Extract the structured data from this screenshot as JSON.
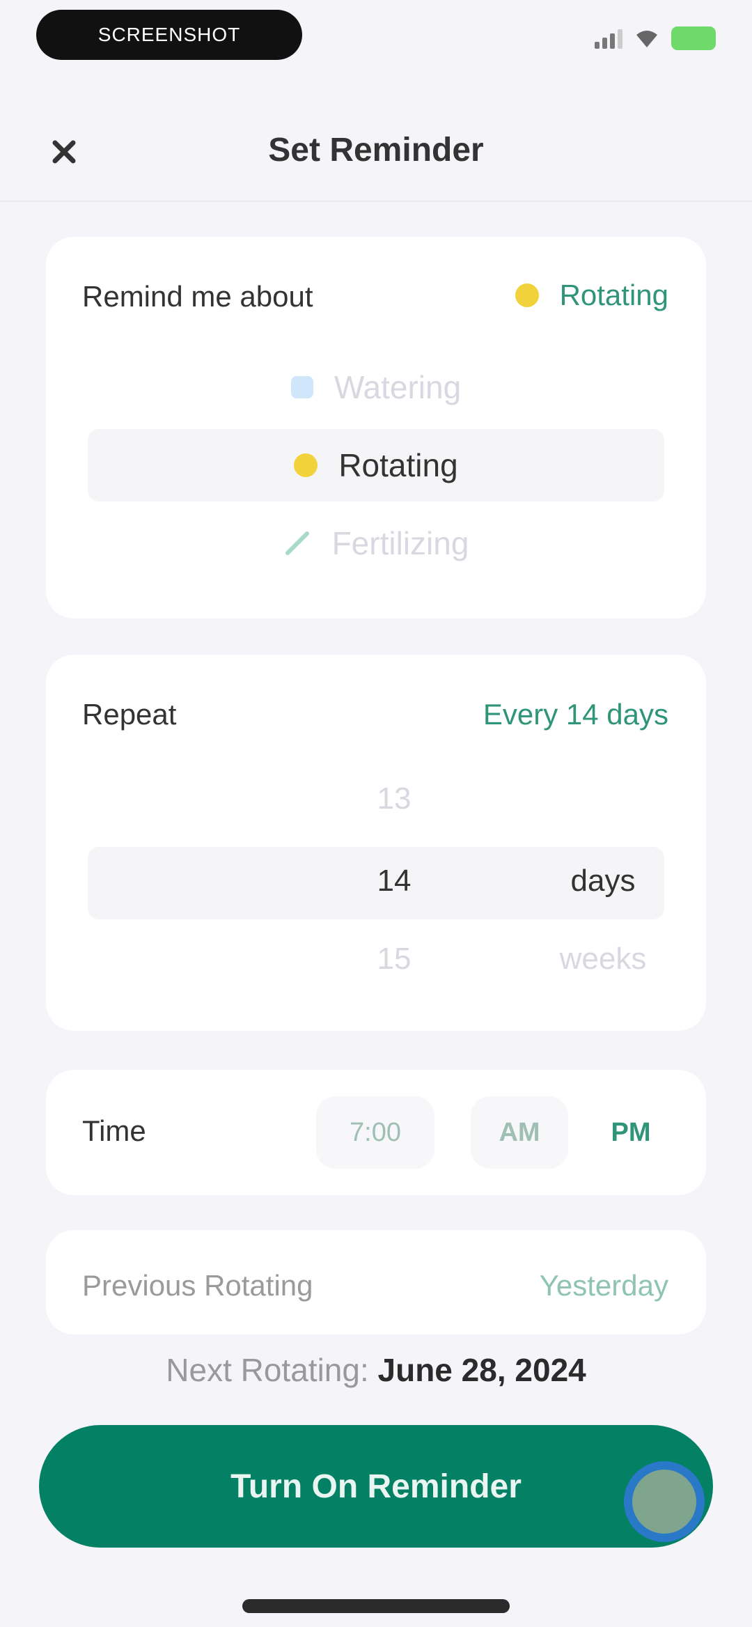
{
  "status_bar": {
    "pill_text": "SCREENSHOT",
    "battery_color": "#6fd96a"
  },
  "header": {
    "title": "Set Reminder",
    "close_icon": "close-icon"
  },
  "remind_card": {
    "label": "Remind me about",
    "value": "Rotating",
    "options": [
      {
        "label": "Watering",
        "icon": "water-drop-icon"
      },
      {
        "label": "Rotating",
        "icon": "sun-icon"
      },
      {
        "label": "Fertilizing",
        "icon": "fertilizer-icon"
      }
    ]
  },
  "repeat_card": {
    "label": "Repeat",
    "value": "Every 14 days",
    "numbers": [
      "13",
      "14",
      "15"
    ],
    "units": [
      "",
      "days",
      "weeks"
    ]
  },
  "time_card": {
    "label": "Time",
    "time": "7:00",
    "am": "AM",
    "pm": "PM"
  },
  "previous_card": {
    "label": "Previous Rotating",
    "value": "Yesterday"
  },
  "next": {
    "prefix": "Next Rotating:",
    "date": "June 28, 2024"
  },
  "cta": {
    "label": "Turn On Reminder"
  },
  "colors": {
    "accent": "#048065",
    "accent_text": "#2f9478",
    "background": "#f5f5f9"
  }
}
